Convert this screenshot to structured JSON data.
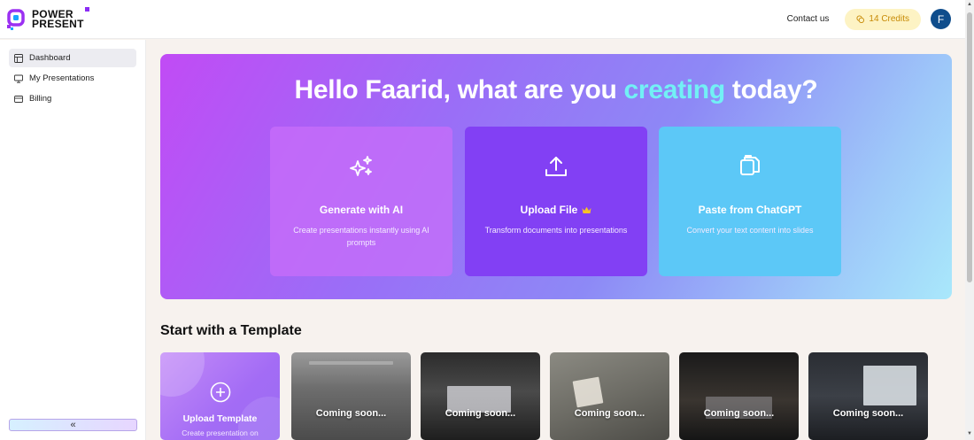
{
  "header": {
    "logo_line1": "POWER",
    "logo_line2": "PRESENT",
    "contact_label": "Contact us",
    "credits_label": "14 Credits",
    "avatar_initial": "F"
  },
  "sidebar": {
    "items": [
      {
        "label": "Dashboard",
        "icon": "layout-icon",
        "active": true
      },
      {
        "label": "My Presentations",
        "icon": "monitor-icon",
        "active": false
      },
      {
        "label": "Billing",
        "icon": "card-icon",
        "active": false
      }
    ],
    "collapse_label": "«"
  },
  "hero": {
    "greeting_prefix": "Hello Faarid, what are you ",
    "greeting_highlight": "creating",
    "greeting_suffix": " today?",
    "cards": [
      {
        "title": "Generate with AI",
        "description": "Create presentations instantly using AI prompts",
        "icon": "sparkles-icon"
      },
      {
        "title": "Upload File",
        "description": "Transform documents into presentations",
        "icon": "upload-icon",
        "badge": "crown-icon"
      },
      {
        "title": "Paste from ChatGPT",
        "description": "Convert your text content into slides",
        "icon": "paste-icon"
      }
    ]
  },
  "templates": {
    "section_title": "Start with a Template",
    "upload": {
      "title": "Upload Template",
      "description": "Create presentation on"
    },
    "coming_soon_label": "Coming soon..."
  },
  "colors": {
    "accent": "#8240f4",
    "highlight": "#72f0f5",
    "credits_bg": "#fdf3c4",
    "credits_text": "#c78a05",
    "avatar_bg": "#0f4d8c"
  }
}
